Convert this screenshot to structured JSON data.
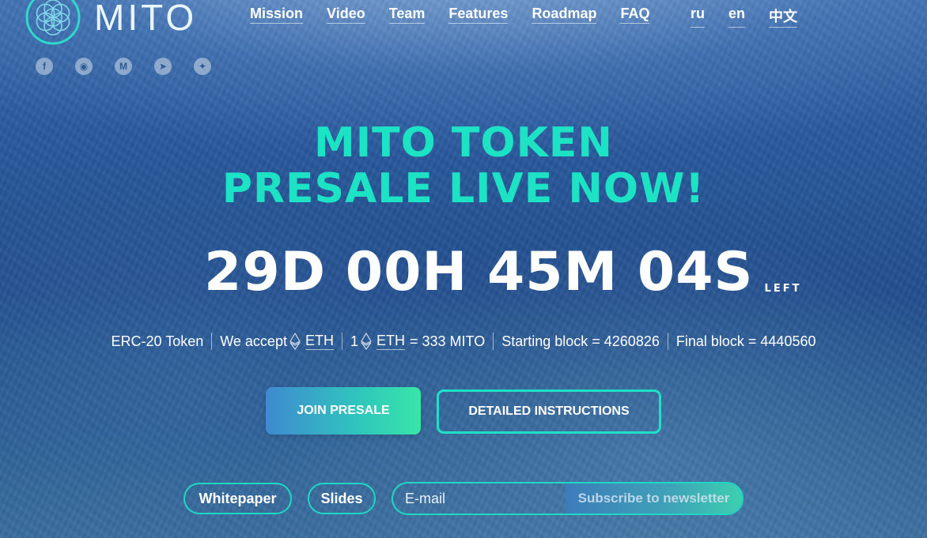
{
  "logo": {
    "text": "MITO",
    "icon": "flower-of-life-icon"
  },
  "nav": {
    "items": [
      "Mission",
      "Video",
      "Team",
      "Features",
      "Roadmap",
      "FAQ"
    ]
  },
  "languages": [
    "ru",
    "en",
    "中文"
  ],
  "social": [
    {
      "icon": "facebook-icon",
      "glyph": "f"
    },
    {
      "icon": "github-icon",
      "glyph": "◉"
    },
    {
      "icon": "medium-icon",
      "glyph": "M"
    },
    {
      "icon": "telegram-icon",
      "glyph": "➤"
    },
    {
      "icon": "twitter-icon",
      "glyph": "✦"
    }
  ],
  "hero": {
    "line1": "MITO TOKEN",
    "line2": "PRESALE LIVE NOW!",
    "countdown": "29D 00H 45M 04S",
    "countdown_suffix": "LEFT"
  },
  "info": {
    "token_type": "ERC-20 Token",
    "accept_label": "We accept",
    "accept_currency": "ETH",
    "rate_prefix": "1",
    "rate_currency": "ETH",
    "rate_value": "= 333 MITO",
    "starting_block": "Starting block = 4260826",
    "final_block": "Final block = 4440560"
  },
  "buttons": {
    "join": "JOIN PRESALE",
    "instructions": "DETAILED INSTRUCTIONS",
    "whitepaper": "Whitepaper",
    "slides": "Slides"
  },
  "newsletter": {
    "placeholder": "E-mail",
    "subscribe": "Subscribe to newsletter"
  },
  "colors": {
    "accent": "#1de3c5",
    "background": "#2a5a9e"
  }
}
